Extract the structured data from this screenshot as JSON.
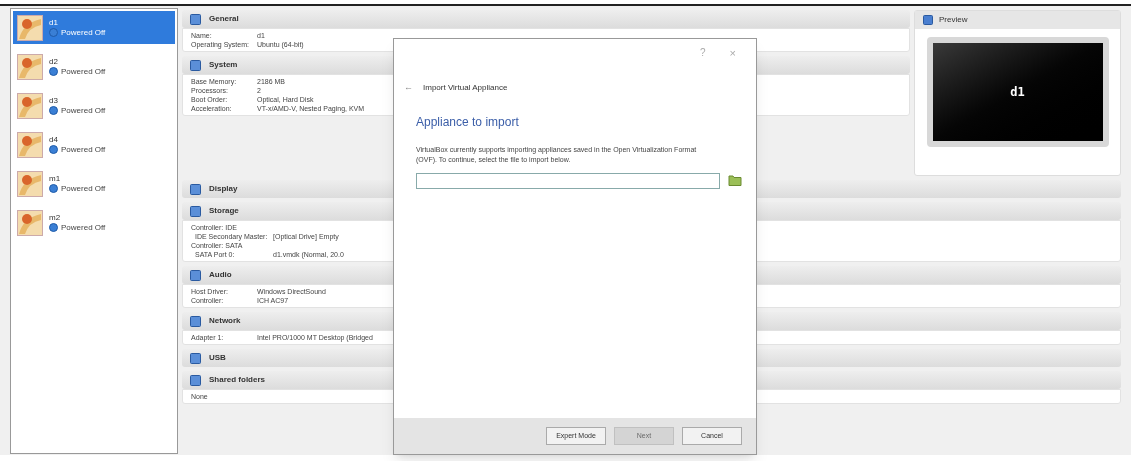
{
  "vm_list": [
    {
      "name": "d1",
      "status": "Powered Off",
      "selected": true
    },
    {
      "name": "d2",
      "status": "Powered Off",
      "selected": false
    },
    {
      "name": "d3",
      "status": "Powered Off",
      "selected": false
    },
    {
      "name": "d4",
      "status": "Powered Off",
      "selected": false
    },
    {
      "name": "m1",
      "status": "Powered Off",
      "selected": false
    },
    {
      "name": "m2",
      "status": "Powered Off",
      "selected": false
    }
  ],
  "top_sections": [
    {
      "title": "General",
      "rows": [
        {
          "label": "Name:",
          "value": "d1"
        },
        {
          "label": "Operating System:",
          "value": "Ubuntu (64-bit)"
        }
      ]
    },
    {
      "title": "System",
      "rows": [
        {
          "label": "Base Memory:",
          "value": "2186 MB"
        },
        {
          "label": "Processors:",
          "value": "2"
        },
        {
          "label": "Boot Order:",
          "value": "Optical, Hard Disk"
        },
        {
          "label": "Acceleration:",
          "value": "VT-x/AMD-V, Nested Paging, KVM"
        }
      ]
    }
  ],
  "preview": {
    "title": "Preview",
    "screen_label": "d1"
  },
  "sections": [
    {
      "title": "Display"
    },
    {
      "title": "Storage",
      "rows": [
        {
          "label": "Controller: IDE",
          "children": [
            {
              "label": "IDE Secondary Master:",
              "value": "[Optical Drive] Empty"
            }
          ]
        },
        {
          "label": "Controller: SATA",
          "children": [
            {
              "label": "SATA Port 0:",
              "value": "d1.vmdk (Normal, 20.0"
            }
          ]
        }
      ]
    },
    {
      "title": "Audio",
      "rows": [
        {
          "label": "Host Driver:",
          "value": "Windows DirectSound"
        },
        {
          "label": "Controller:",
          "value": "ICH AC97"
        }
      ]
    },
    {
      "title": "Network",
      "rows": [
        {
          "label": "Adapter 1:",
          "value": "Intel PRO/1000 MT Desktop (Bridged"
        }
      ]
    },
    {
      "title": "USB"
    },
    {
      "title": "Shared folders",
      "rows": [
        {
          "label": "None"
        }
      ]
    }
  ],
  "dialog": {
    "help": "?",
    "close": "×",
    "back": "←",
    "title": "Import Virtual Appliance",
    "heading": "Appliance to import",
    "text": "VirtualBox currently supports importing appliances saved in the Open Virtualization Format (OVF). To continue, select the file to import below.",
    "buttons": [
      {
        "label": "Expert Mode",
        "disabled": false
      },
      {
        "label": "Next",
        "disabled": true
      },
      {
        "label": "Cancel",
        "disabled": false
      }
    ]
  }
}
